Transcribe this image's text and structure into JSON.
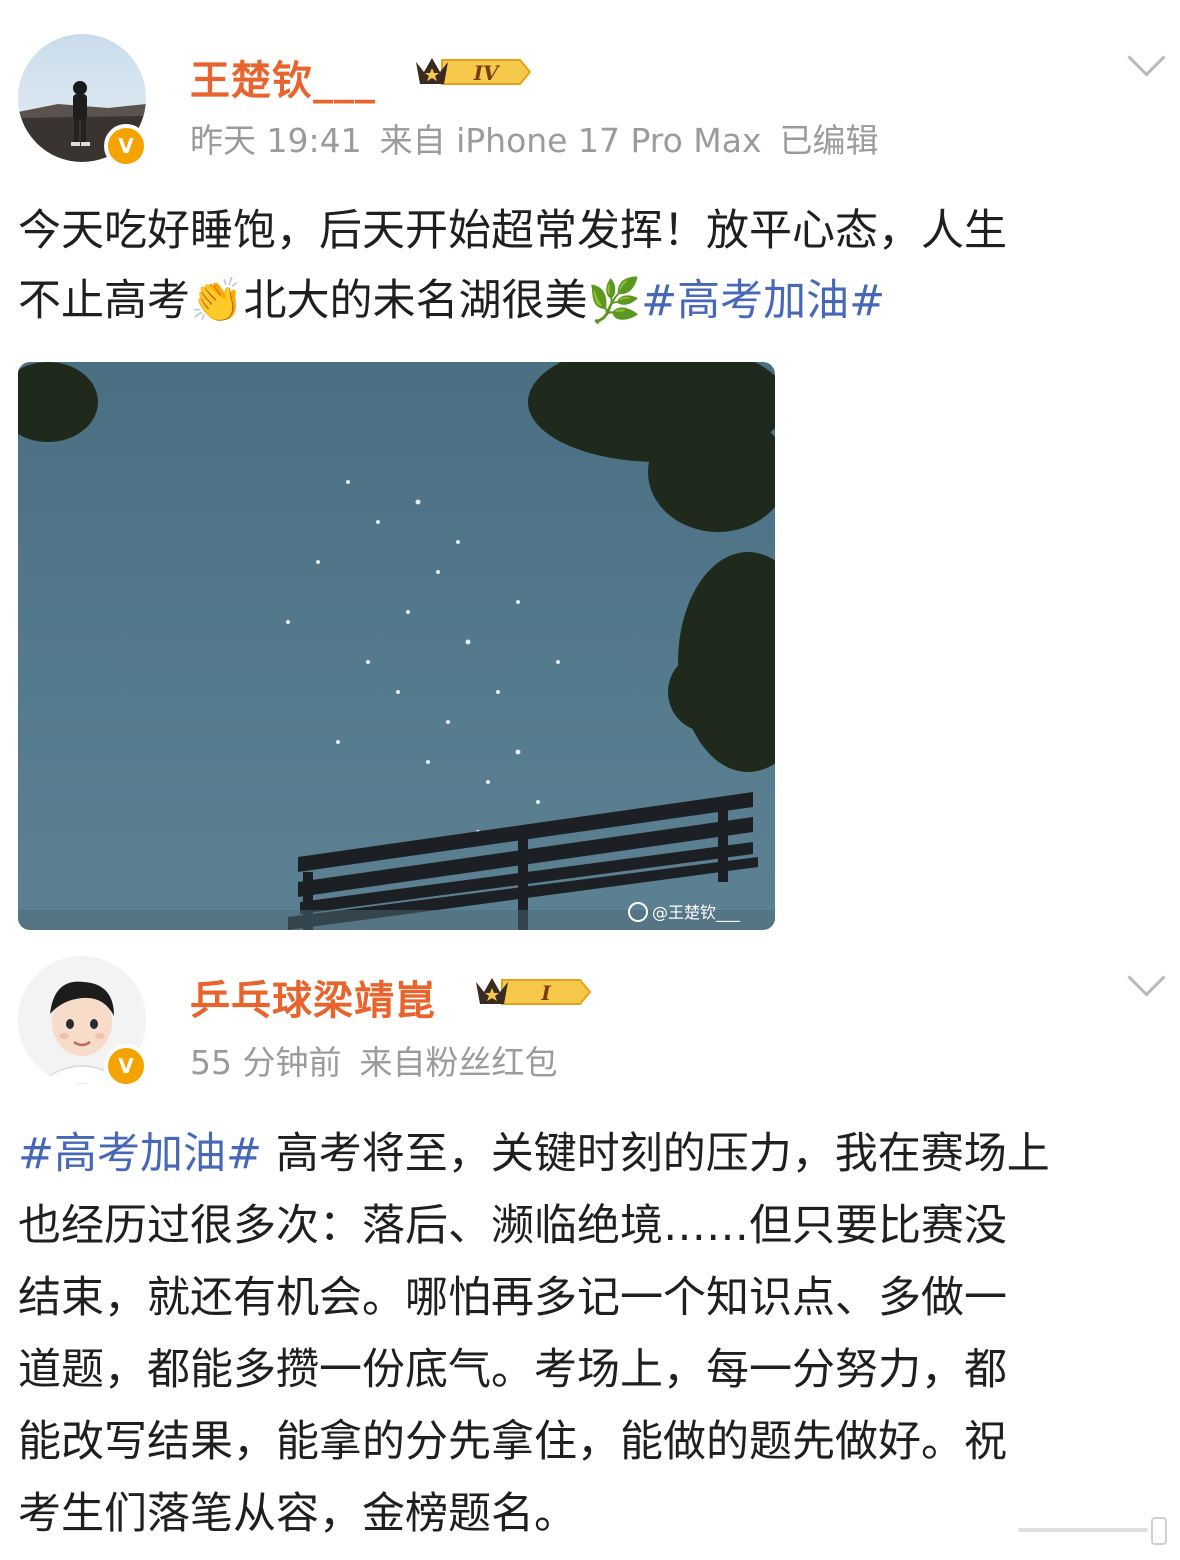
{
  "posts": [
    {
      "username": "王楚钦___",
      "level": "IV",
      "time": "昨天 19:41",
      "source": "来自 iPhone 17 Pro Max",
      "edited": "已编辑",
      "text_line1": "今天吃好睡饱，后天开始超常发挥！放平心态，人生",
      "text_line2_a": "不止高考",
      "emoji_clap": "👏",
      "text_line2_b": "北大的未名湖很美",
      "emoji_herb": "🌿",
      "hashtag": "#高考加油#",
      "image_watermark": "@王楚钦___"
    },
    {
      "username": "乒乓球梁靖崑",
      "level": "I",
      "time": "55 分钟前",
      "source": "来自粉丝红包",
      "hashtag": "#高考加油#",
      "text_lines": [
        " 高考将至，关键时刻的压力，我在赛场上",
        "也经历过很多次：落后、濒临绝境……但只要比赛没",
        "结束，就还有机会。哪怕再多记一个知识点、多做一",
        "道题，都能多攒一份底气。考场上，每一分努力，都",
        "能改写结果，能拿的分先拿住，能做的题先做好。祝",
        "考生们落笔从容，金榜题名。"
      ]
    }
  ],
  "colors": {
    "username": "#e8642c",
    "hashtag": "#4768b8",
    "meta": "#9b9b9b",
    "verified": "#f5a300"
  },
  "icons": [
    "verified-badge-icon",
    "crown-level-icon",
    "chevron-down-icon",
    "weibo-logo-icon"
  ]
}
